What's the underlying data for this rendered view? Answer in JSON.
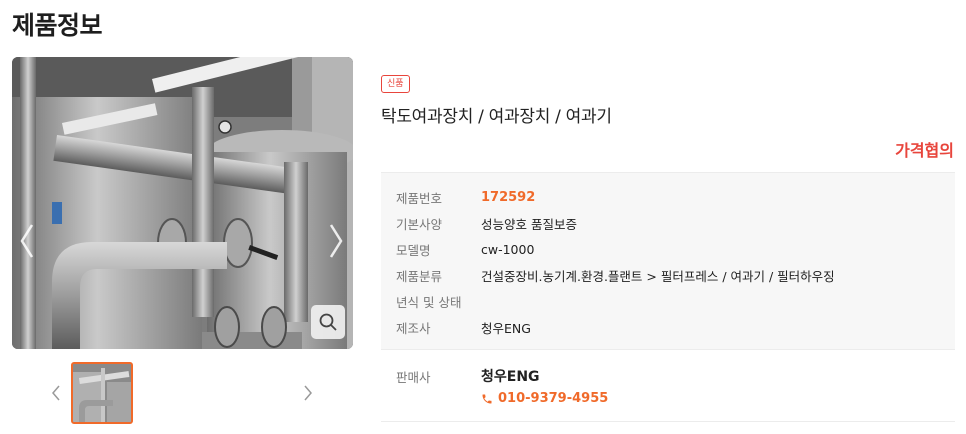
{
  "page": {
    "title": "제품정보"
  },
  "product": {
    "badge": "신품",
    "title": "탁도여과장치 / 여과장치 / 여과기",
    "price": "가격협의"
  },
  "specs": [
    {
      "label": "제품번호",
      "value": "172592"
    },
    {
      "label": "기본사양",
      "value": "성능양호 품질보증"
    },
    {
      "label": "모델명",
      "value": "cw-1000"
    },
    {
      "label": "제품분류",
      "value": "건설중장비.농기계.환경.플랜트 > 필터프레스 / 여과기 / 필터하우징"
    },
    {
      "label": "년식 및 상태",
      "value": ""
    },
    {
      "label": "제조사",
      "value": "청우ENG"
    }
  ],
  "seller": {
    "label": "판매사",
    "name": "청우ENG",
    "phone": "010-9379-4955"
  },
  "colors": {
    "accent_orange": "#f06a2a",
    "price_red": "#e8453c"
  },
  "icons": {
    "prev": "chevron-left-icon",
    "next": "chevron-right-icon",
    "zoom": "magnifier-icon",
    "phone": "phone-icon"
  }
}
